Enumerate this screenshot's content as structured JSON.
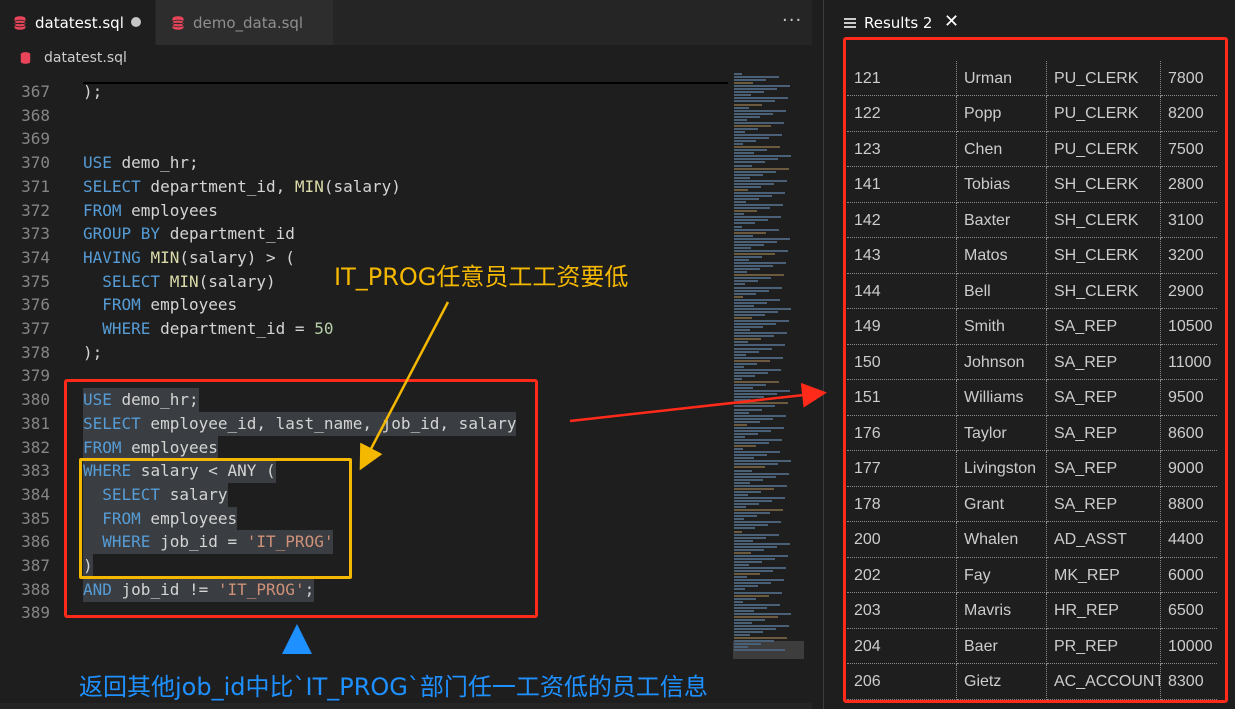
{
  "editor": {
    "tabs": [
      {
        "label": "datatest.sql",
        "active": true,
        "unsaved": true
      },
      {
        "label": "demo_data.sql",
        "active": false
      }
    ],
    "breadcrumb": "datatest.sql",
    "lines": [
      {
        "n": "367",
        "tokens": [
          {
            "t": ");",
            "c": "id"
          }
        ]
      },
      {
        "n": "368",
        "tokens": []
      },
      {
        "n": "369",
        "tokens": []
      },
      {
        "n": "370",
        "tokens": [
          {
            "t": "USE",
            "c": "kw"
          },
          {
            "t": " demo_hr;",
            "c": "id"
          }
        ]
      },
      {
        "n": "371",
        "tokens": [
          {
            "t": "SELECT",
            "c": "kw"
          },
          {
            "t": " department_id, ",
            "c": "id"
          },
          {
            "t": "MIN",
            "c": "fn"
          },
          {
            "t": "(salary)",
            "c": "id"
          }
        ]
      },
      {
        "n": "372",
        "tokens": [
          {
            "t": "FROM",
            "c": "kw"
          },
          {
            "t": " employees",
            "c": "id"
          }
        ]
      },
      {
        "n": "373",
        "tokens": [
          {
            "t": "GROUP BY",
            "c": "kw"
          },
          {
            "t": " department_id",
            "c": "id"
          }
        ]
      },
      {
        "n": "374",
        "tokens": [
          {
            "t": "HAVING",
            "c": "kw"
          },
          {
            "t": " ",
            "c": "id"
          },
          {
            "t": "MIN",
            "c": "fn"
          },
          {
            "t": "(salary) > (",
            "c": "id"
          }
        ]
      },
      {
        "n": "375",
        "tokens": [
          {
            "t": "  SELECT",
            "c": "kw"
          },
          {
            "t": " ",
            "c": "id"
          },
          {
            "t": "MIN",
            "c": "fn"
          },
          {
            "t": "(salary)",
            "c": "id"
          }
        ]
      },
      {
        "n": "376",
        "tokens": [
          {
            "t": "  FROM",
            "c": "kw"
          },
          {
            "t": " employees",
            "c": "id"
          }
        ]
      },
      {
        "n": "377",
        "tokens": [
          {
            "t": "  WHERE",
            "c": "kw"
          },
          {
            "t": " department_id = ",
            "c": "id"
          },
          {
            "t": "50",
            "c": "num"
          }
        ]
      },
      {
        "n": "378",
        "tokens": [
          {
            "t": ");",
            "c": "id"
          }
        ]
      },
      {
        "n": "379",
        "tokens": []
      },
      {
        "n": "380",
        "sel": true,
        "tokens": [
          {
            "t": "USE",
            "c": "kw"
          },
          {
            "t": " demo_hr;",
            "c": "id"
          }
        ]
      },
      {
        "n": "381",
        "sel": true,
        "tokens": [
          {
            "t": "SELECT",
            "c": "kw"
          },
          {
            "t": " employee_id, last_name, job_id, salary",
            "c": "id"
          }
        ]
      },
      {
        "n": "382",
        "sel": true,
        "tokens": [
          {
            "t": "FROM",
            "c": "kw"
          },
          {
            "t": " employees",
            "c": "id"
          }
        ]
      },
      {
        "n": "383",
        "sel": true,
        "tokens": [
          {
            "t": "WHERE",
            "c": "kw"
          },
          {
            "t": " salary < ANY (",
            "c": "id"
          }
        ]
      },
      {
        "n": "384",
        "sel": true,
        "tokens": [
          {
            "t": "  SELECT",
            "c": "kw"
          },
          {
            "t": " salary",
            "c": "id"
          }
        ]
      },
      {
        "n": "385",
        "sel": true,
        "tokens": [
          {
            "t": "  FROM",
            "c": "kw"
          },
          {
            "t": " employees",
            "c": "id"
          }
        ]
      },
      {
        "n": "386",
        "sel": true,
        "tokens": [
          {
            "t": "  WHERE",
            "c": "kw"
          },
          {
            "t": " job_id = ",
            "c": "id"
          },
          {
            "t": "'IT_PROG'",
            "c": "str"
          }
        ]
      },
      {
        "n": "387",
        "sel": true,
        "tokens": [
          {
            "t": ")",
            "c": "id"
          }
        ]
      },
      {
        "n": "388",
        "sel": true,
        "tokens": [
          {
            "t": "AND",
            "c": "kw"
          },
          {
            "t": " job_id != ",
            "c": "id"
          },
          {
            "t": "'IT_PROG'",
            "c": "str"
          },
          {
            "t": ";",
            "c": "id"
          }
        ]
      },
      {
        "n": "389",
        "tokens": []
      }
    ]
  },
  "results": {
    "tab_label": "Results 2",
    "rows": [
      [
        "121",
        "Urman",
        "PU_CLERK",
        "7800"
      ],
      [
        "122",
        "Popp",
        "PU_CLERK",
        "8200"
      ],
      [
        "123",
        "Chen",
        "PU_CLERK",
        "7500"
      ],
      [
        "141",
        "Tobias",
        "SH_CLERK",
        "2800"
      ],
      [
        "142",
        "Baxter",
        "SH_CLERK",
        "3100"
      ],
      [
        "143",
        "Matos",
        "SH_CLERK",
        "3200"
      ],
      [
        "144",
        "Bell",
        "SH_CLERK",
        "2900"
      ],
      [
        "149",
        "Smith",
        "SA_REP",
        "10500"
      ],
      [
        "150",
        "Johnson",
        "SA_REP",
        "11000"
      ],
      [
        "151",
        "Williams",
        "SA_REP",
        "9500"
      ],
      [
        "176",
        "Taylor",
        "SA_REP",
        "8600"
      ],
      [
        "177",
        "Livingston",
        "SA_REP",
        "9000"
      ],
      [
        "178",
        "Grant",
        "SA_REP",
        "8800"
      ],
      [
        "200",
        "Whalen",
        "AD_ASST",
        "4400"
      ],
      [
        "202",
        "Fay",
        "MK_REP",
        "6000"
      ],
      [
        "203",
        "Mavris",
        "HR_REP",
        "6500"
      ],
      [
        "204",
        "Baer",
        "PR_REP",
        "10000"
      ],
      [
        "206",
        "Gietz",
        "AC_ACCOUNT",
        "8300"
      ]
    ]
  },
  "annotations": {
    "yellow_note": "IT_PROG任意员工工资要低",
    "blue_note": "返回其他job_id中比`IT_PROG`部门任一工资低的员工信息"
  },
  "colors": {
    "red_box": "#ff2a1a",
    "yellow_box": "#f5b800",
    "blue_note": "#1e90ff"
  }
}
